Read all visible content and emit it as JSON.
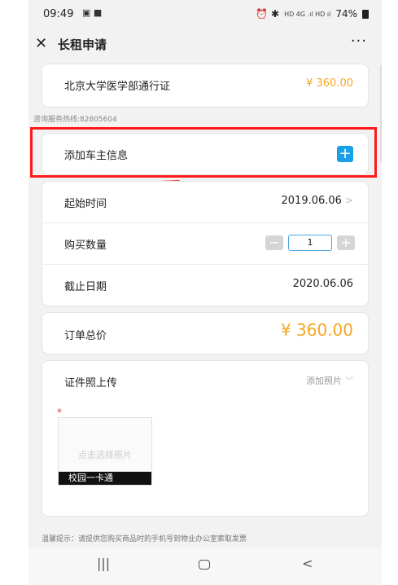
{
  "status_bar": {
    "time": "09:49",
    "left_icons": "▣ ■",
    "right_icons": "⏰ ✱",
    "signal_text": "HD 4G .ıl HD ıl",
    "battery": "74%"
  },
  "header": {
    "title": "长租申请",
    "more": "···"
  },
  "pass": {
    "name": "北京大学医学部通行证",
    "price": "¥ 360.00"
  },
  "hotline": "咨询服务热线:82805604",
  "owner": {
    "label": "添加车主信息",
    "add_symbol": "+"
  },
  "schedule": {
    "start_label": "起始时间",
    "start_value": "2019.06.06",
    "qty_label": "购买数量",
    "qty_value": "1",
    "minus": "−",
    "plus": "+",
    "end_label": "截止日期",
    "end_value": "2020.06.06"
  },
  "total": {
    "label": "订单总价",
    "value": "¥ 360.00"
  },
  "upload": {
    "label": "证件照上传",
    "add_label": "添加照片",
    "required_mark": "*",
    "placeholder": "点击选择照片",
    "caption": "校园一卡通"
  },
  "tip": "温馨提示：请提供您购买商品时的手机号到物业办公室索取发票",
  "nav": {
    "recent": "|||",
    "back": "<"
  },
  "colors": {
    "accent_orange": "#f5a623",
    "add_blue": "#1aa0e6",
    "highlight_red": "#ff1a1a"
  }
}
